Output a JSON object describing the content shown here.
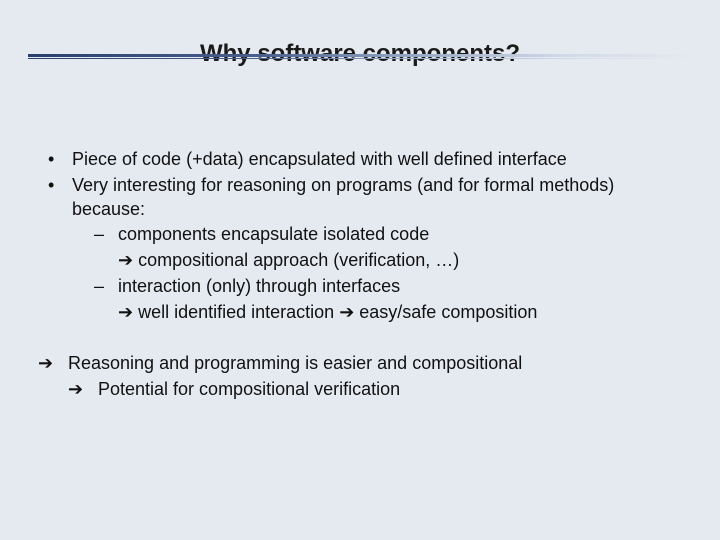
{
  "title": "Why software components?",
  "bullets": {
    "b1": "Piece of code (+data) encapsulated with well defined interface",
    "b2": "Very interesting for reasoning on programs (and for formal methods) because:",
    "b2_sub1": "components encapsulate isolated code",
    "b2_sub1_arrow": "➔ compositional approach (verification, …)",
    "b2_sub2": "interaction (only) through interfaces",
    "b2_sub2_arrow": "➔ well identified interaction ➔ easy/safe composition"
  },
  "summary": {
    "line1_arrow": "➔",
    "line1": "Reasoning and programming is easier and compositional",
    "line2_arrow": "➔",
    "line2": "Potential for compositional verification"
  }
}
